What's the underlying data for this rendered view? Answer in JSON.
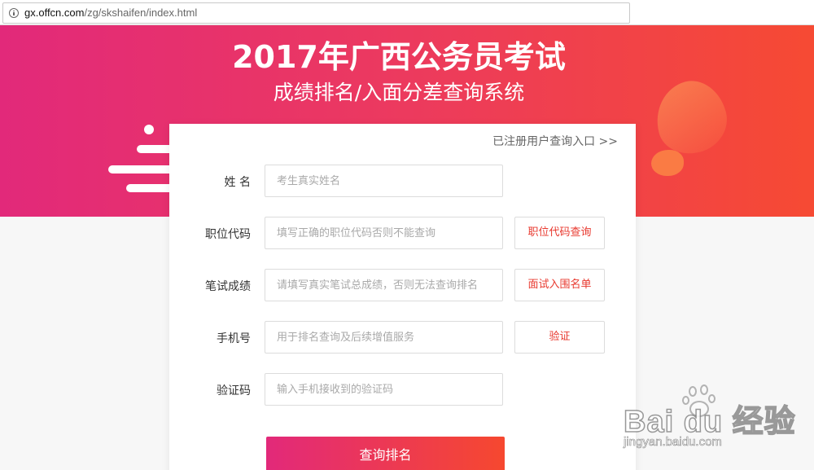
{
  "browser": {
    "url_host": "gx.offcn.com",
    "url_path": "/zg/skshaifen/index.html"
  },
  "hero": {
    "title": "2017年广西公务员考试",
    "subtitle": "成绩排名/入面分差查询系统"
  },
  "form": {
    "registered_link": "已注册用户查询入口 >>",
    "fields": [
      {
        "label": "姓 名",
        "placeholder": "考生真实姓名"
      },
      {
        "label": "职位代码",
        "placeholder": "填写正确的职位代码否则不能查询",
        "button": "职位代码查询"
      },
      {
        "label": "笔试成绩",
        "placeholder": "请填写真实笔试总成绩，否则无法查询排名",
        "button": "面试入围名单"
      },
      {
        "label": "手机号",
        "placeholder": "用于排名查询及后续增值服务",
        "button": "验证"
      },
      {
        "label": "验证码",
        "placeholder": "输入手机接收到的验证码"
      }
    ],
    "submit_label": "查询排名"
  },
  "watermark": {
    "logo_text": "Bai du 经验",
    "url": "jingyan.baidu.com"
  },
  "colors": {
    "gradient_start": "#e2297a",
    "gradient_end": "#f64a33",
    "button_text": "#e8382e"
  }
}
